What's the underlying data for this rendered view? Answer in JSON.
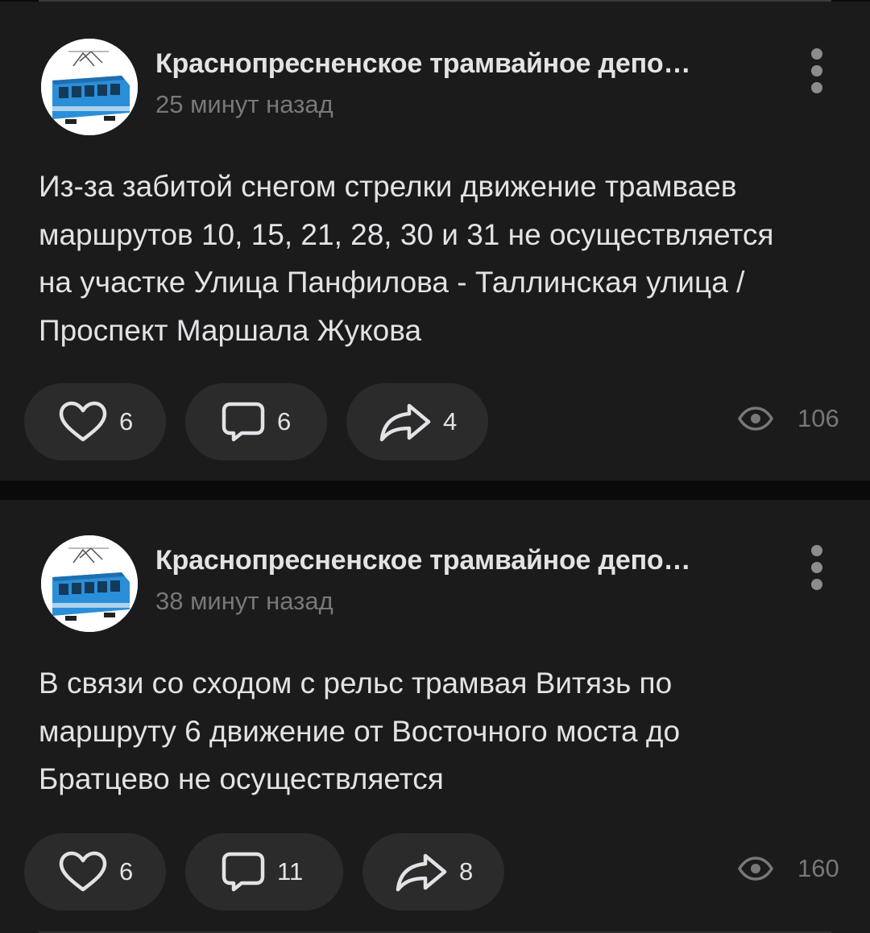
{
  "posts": [
    {
      "author": "Краснопресненское трамвайное депо…",
      "time": "25 минут назад",
      "lines": [
        "Из-за забитой снегом стрелки движение трамваев",
        "маршрутов 10, 15, 21, 28, 30 и 31 не осуществляется",
        "на участке Улица Панфилова - Таллинская улица /",
        "Проспект Маршала Жукова"
      ],
      "likes": "6",
      "comments": "6",
      "shares": "4",
      "views": "106"
    },
    {
      "author": "Краснопресненское трамвайное депо…",
      "time": "38 минут назад",
      "lines": [
        "В связи со сходом с рельс трамвая Витязь по",
        "маршруту 6 движение от Восточного моста до",
        "Братцево не осуществляется"
      ],
      "likes": "6",
      "comments": "11",
      "shares": "8",
      "views": "160"
    }
  ],
  "icons": {
    "like": "heart-icon",
    "comment": "comment-icon",
    "share": "share-arrow-icon",
    "views": "eye-icon",
    "more": "more-vertical-icon"
  },
  "colors": {
    "background": "#0a0a0a",
    "card": "#1b1b1b",
    "pill": "#2b2b2b",
    "primary_text": "#e1e3e6",
    "secondary_text": "#76787a",
    "icon": "#e1e3e6",
    "tram_blue": "#2a8fd8"
  }
}
